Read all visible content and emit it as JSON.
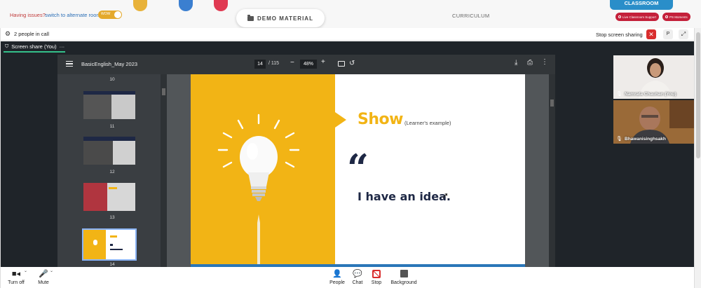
{
  "header": {
    "issues_text": "Having issues?",
    "switch_link": "switch to alternate room",
    "toggle_label": "WOW",
    "demo_material_label": "DEMO MATERIAL",
    "curriculum_label": "CURRICULUM",
    "classroom_tab_label": "CLASSROOM",
    "live_support_label": "Live Classroom Support",
    "ps_moments_label": "PS Moments"
  },
  "call": {
    "people_count_label": "2 people in call",
    "stop_sharing_label": "Stop screen sharing",
    "p_button_label": "P",
    "share_tab_label": "Screen share (You)",
    "share_tab_more": "···"
  },
  "pdf": {
    "doc_title": "BasicEnglish_May 2023",
    "current_page": "14",
    "page_total": "/ 115",
    "zoom": "48%",
    "thumbnails": [
      {
        "page": "10"
      },
      {
        "page": "11"
      },
      {
        "page": "12"
      },
      {
        "page": "13"
      },
      {
        "page": "14",
        "selected": true
      }
    ],
    "slide": {
      "show_word": "Show",
      "show_sub": "(Learner's example)",
      "quote_mark": "“",
      "quote_text": "I have an idea."
    }
  },
  "participants": [
    {
      "name": "Namrata Chauhan (You)"
    },
    {
      "name": "Bhawanisinghsakh"
    }
  ],
  "controls": {
    "turn_off": "Turn off",
    "mute": "Mute",
    "people": "People",
    "chat": "Chat",
    "stop": "Stop",
    "background": "Background"
  },
  "colors": {
    "accent_yellow": "#f2b415",
    "navy": "#1e2845",
    "stop_red": "#d92d2d",
    "share_green": "#34c08a",
    "viewer_dark": "#323639"
  }
}
